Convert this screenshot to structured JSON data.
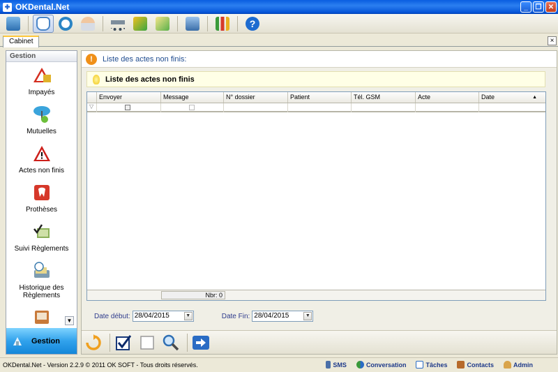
{
  "window": {
    "title": "OKDental.Net"
  },
  "tab": {
    "label": "Cabinet",
    "close": "×"
  },
  "sidebar": {
    "header": "Gestion",
    "items": [
      {
        "label": "Impayés",
        "icon": "unpaid-icon"
      },
      {
        "label": "Mutuelles",
        "icon": "mutual-icon"
      },
      {
        "label": "Actes non finis",
        "icon": "warning-icon"
      },
      {
        "label": "Prothèses",
        "icon": "prosthesis-icon"
      },
      {
        "label": "Suivi Règlements",
        "icon": "payment-tracking-icon"
      },
      {
        "label": "Historique des Règlements",
        "icon": "payment-history-icon"
      },
      {
        "label": "",
        "icon": "inbox-icon"
      }
    ],
    "nav_button": "Gestion"
  },
  "main": {
    "header_title": "Liste des actes non finis:",
    "info_title": "Liste des actes non finis",
    "columns": [
      "Envoyer",
      "Message",
      "N° dossier",
      "Patient",
      "Tél. GSM",
      "Acte",
      "Date"
    ],
    "footer_count": "Nbr: 0",
    "date_start_label": "Date début:",
    "date_start_value": "28/04/2015",
    "date_end_label": "Date Fin:",
    "date_end_value": "28/04/2015"
  },
  "status": {
    "copyright": "OKDental.Net - Version 2.2.9 © 2011 OK SOFT - Tous droits réservés.",
    "links": [
      "SMS",
      "Conversation",
      "Tâches",
      "Contacts",
      "Admin"
    ]
  },
  "colors": {
    "accent": "#0a5ee0",
    "nav_active": "#31a2ec",
    "header_text": "#1e4b8f"
  }
}
